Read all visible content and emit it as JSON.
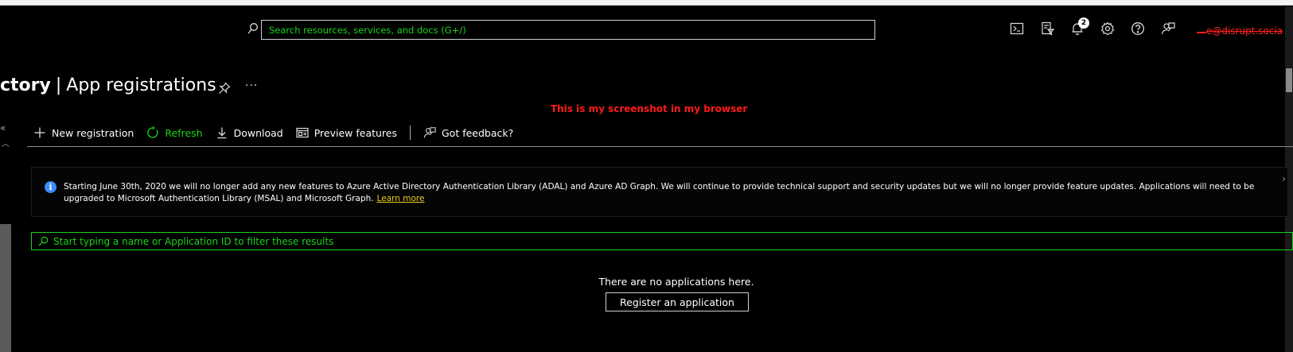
{
  "header": {
    "search_placeholder": "Search resources, services, and docs (G+/)",
    "notification_count": "2",
    "account_label": "e@disrupt.socia",
    "icons": [
      "cloud-shell-icon",
      "directory-filter-icon",
      "bell-icon",
      "gear-icon",
      "help-icon",
      "feedback-icon"
    ]
  },
  "page": {
    "title_bold": "ctory",
    "title_separator": "|",
    "title_rest": "App registrations",
    "more": "···"
  },
  "annotation": "This is my screenshot in my browser",
  "toolbar": {
    "new_registration": "New registration",
    "refresh": "Refresh",
    "download": "Download",
    "preview_features": "Preview features",
    "feedback": "Got feedback?"
  },
  "banner": {
    "text": "Starting June 30th, 2020 we will no longer add any new features to Azure Active Directory Authentication Library (ADAL) and Azure AD Graph. We will continue to provide technical support and security updates but we will no longer provide feature updates. Applications will need to be upgraded to Microsoft Authentication Library (MSAL) and Microsoft Graph.",
    "link": "Learn more"
  },
  "filter": {
    "placeholder": "Start typing a name or Application ID to filter these results"
  },
  "empty_state": {
    "message": "There are no applications here.",
    "button": "Register an application"
  },
  "colors": {
    "accent_green": "#1bd31b",
    "annotation_red": "#ff1a1a",
    "info_blue": "#3b8cff",
    "link_yellow": "#e8d01a"
  }
}
